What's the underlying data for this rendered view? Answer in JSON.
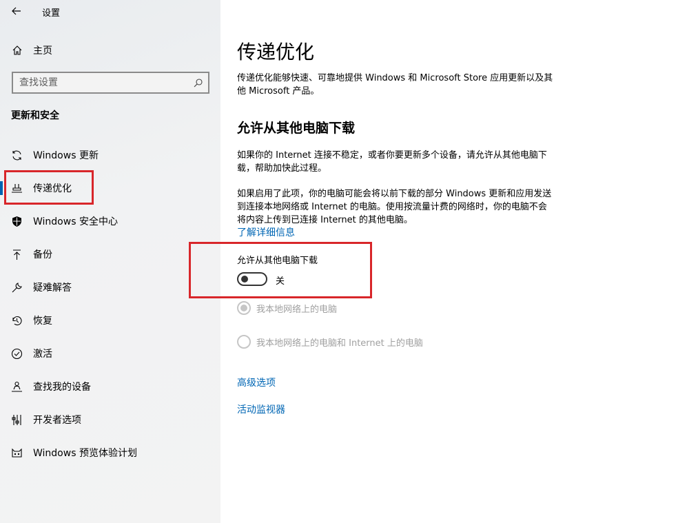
{
  "app": {
    "title": "设置",
    "back_icon": "back-arrow-icon"
  },
  "sidebar": {
    "home_label": "主页",
    "search_placeholder": "查找设置",
    "section_heading": "更新和安全",
    "active_item": "传递优化",
    "items": [
      {
        "label": "Windows 更新",
        "icon": "refresh-icon"
      },
      {
        "label": "传递优化",
        "icon": "delivery-optimization-icon"
      },
      {
        "label": "Windows 安全中心",
        "icon": "shield-icon"
      },
      {
        "label": "备份",
        "icon": "backup-icon"
      },
      {
        "label": "疑难解答",
        "icon": "wrench-icon"
      },
      {
        "label": "恢复",
        "icon": "recovery-icon"
      },
      {
        "label": "激活",
        "icon": "check-circle-icon"
      },
      {
        "label": "查找我的设备",
        "icon": "person-locate-icon"
      },
      {
        "label": "开发者选项",
        "icon": "developer-icon"
      },
      {
        "label": "Windows 预览体验计划",
        "icon": "insider-icon"
      }
    ]
  },
  "main": {
    "title": "传递优化",
    "description": "传递优化能够快速、可靠地提供 Windows 和 Microsoft Store 应用更新以及其他 Microsoft 产品。",
    "subheading": "允许从其他电脑下载",
    "paragraph1": "如果你的 Internet 连接不稳定，或者你要更新多个设备，请允许从其他电脑下载，帮助加快此过程。",
    "paragraph2": "如果启用了此项，你的电脑可能会将以前下载的部分 Windows 更新和应用发送到连接本地网络或 Internet 的电脑。使用按流量计费的网络时，你的电脑不会将内容上传到已连接 Internet 的其他电脑。",
    "learn_more": "了解详细信息",
    "toggle": {
      "label": "允许从其他电脑下载",
      "state": "关",
      "on": false
    },
    "radio_options": [
      {
        "label": "我本地网络上的电脑",
        "selected": true,
        "disabled": true
      },
      {
        "label": "我本地网络上的电脑和 Internet 上的电脑",
        "selected": false,
        "disabled": true
      }
    ],
    "advanced_options": "高级选项",
    "activity_monitor": "活动监视器"
  },
  "colors": {
    "accent": "#0063b1",
    "link": "#0066b4",
    "highlight_box": "#d8262a",
    "sidebar_bg": "#f3f3f3"
  }
}
